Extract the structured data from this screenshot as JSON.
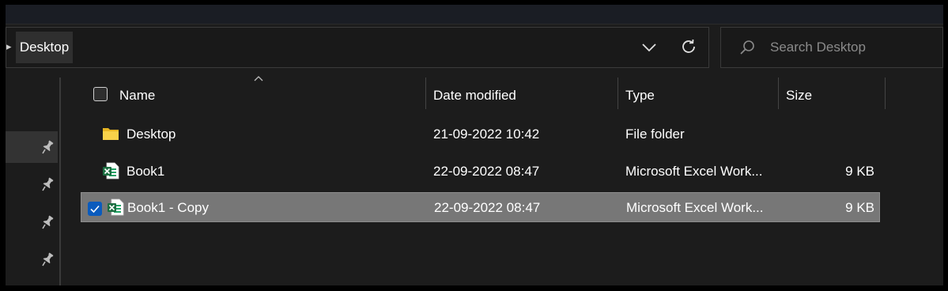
{
  "address": {
    "breadcrumb": "Desktop",
    "dropdown_icon": "chevron-down-icon",
    "refresh_icon": "refresh-icon"
  },
  "search": {
    "placeholder": "Search Desktop",
    "icon": "search-icon"
  },
  "nav": {
    "items": [
      {
        "icon": "pin-icon",
        "selected": true
      },
      {
        "icon": "pin-icon",
        "selected": false
      },
      {
        "icon": "pin-icon",
        "selected": false
      },
      {
        "icon": "pin-icon",
        "selected": false
      }
    ]
  },
  "columns": {
    "name": "Name",
    "date": "Date modified",
    "type": "Type",
    "size": "Size"
  },
  "files": [
    {
      "name": "Desktop",
      "date": "21-09-2022 10:42",
      "type": "File folder",
      "size": "",
      "icon": "folder-icon",
      "selected": false
    },
    {
      "name": "Book1",
      "date": "22-09-2022 08:47",
      "type": "Microsoft Excel Work...",
      "size": "9 KB",
      "icon": "excel-file-icon",
      "selected": false
    },
    {
      "name": "Book1 - Copy",
      "date": "22-09-2022 08:47",
      "type": "Microsoft Excel Work...",
      "size": "9 KB",
      "icon": "excel-file-icon",
      "selected": true
    }
  ],
  "colors": {
    "background": "#1c1c1c",
    "selection": "#777777",
    "checkbox_accent": "#0a5bbd",
    "folder": "#f4c542",
    "excel": "#1d6f42"
  }
}
